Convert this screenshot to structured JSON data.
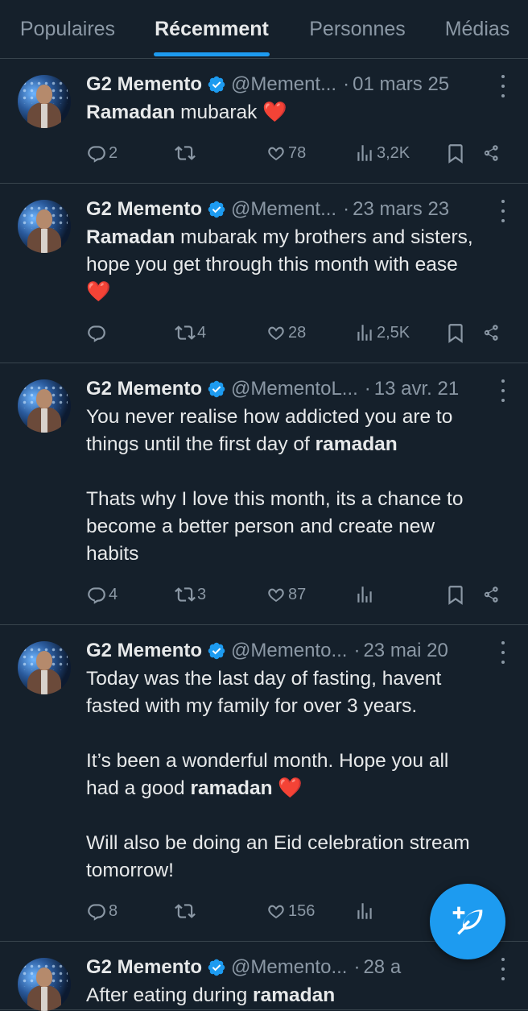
{
  "tabs": [
    {
      "label": "Populaires",
      "active": false
    },
    {
      "label": "Récemment",
      "active": true
    },
    {
      "label": "Personnes",
      "active": false
    },
    {
      "label": "Médias",
      "active": false
    }
  ],
  "tweets": [
    {
      "name": "G2 Memento",
      "handle": "@Mement...",
      "date": "01 mars 25",
      "paragraphs": [
        [
          {
            "b": "Ramadan"
          },
          {
            "t": " mubarak "
          },
          {
            "h": "❤️"
          }
        ]
      ],
      "reply": "2",
      "retweet": "",
      "like": "78",
      "views": "3,2K"
    },
    {
      "name": "G2 Memento",
      "handle": "@Mement...",
      "date": "23 mars 23",
      "paragraphs": [
        [
          {
            "b": "Ramadan"
          },
          {
            "t": " mubarak my brothers and sisters,\nhope you get through this month with ease\n"
          },
          {
            "h": "❤️"
          }
        ]
      ],
      "reply": "",
      "retweet": "4",
      "like": "28",
      "views": "2,5K"
    },
    {
      "name": "G2 Memento",
      "handle": "@MementoL...",
      "date": "13 avr. 21",
      "paragraphs": [
        [
          {
            "t": "You never realise how addicted you are to\nthings until the first day of "
          },
          {
            "b": "ramadan"
          }
        ],
        [
          {
            "t": "Thats why I love this month, its a chance to\nbecome a better person and create new\nhabits"
          }
        ]
      ],
      "reply": "4",
      "retweet": "3",
      "like": "87",
      "views": ""
    },
    {
      "name": "G2 Memento",
      "handle": "@Memento...",
      "date": "23 mai 20",
      "paragraphs": [
        [
          {
            "t": "Today was the last day of fasting, havent\nfasted with my family for over 3 years."
          }
        ],
        [
          {
            "t": "It’s been a wonderful month. Hope you all\nhad a good "
          },
          {
            "b": "ramadan"
          },
          {
            "t": " "
          },
          {
            "h": "❤️"
          }
        ],
        [
          {
            "t": "Will also be doing an Eid celebration stream\ntomorrow!"
          }
        ]
      ],
      "reply": "8",
      "retweet": "",
      "like": "156",
      "views": ""
    },
    {
      "name": "G2 Memento",
      "handle": "@Memento...",
      "date": "28 a",
      "paragraphs": [
        [
          {
            "t": "After eating during "
          },
          {
            "b": "ramadan"
          }
        ]
      ],
      "reply": "",
      "retweet": "",
      "like": "",
      "views": ""
    }
  ],
  "colors": {
    "background": "#15202b",
    "accent": "#1d9bf0",
    "text": "#e7e9ea",
    "muted": "#8b98a5",
    "heart": "#f4212e"
  },
  "fab": {
    "icon": "compose-feather-plus-icon"
  }
}
